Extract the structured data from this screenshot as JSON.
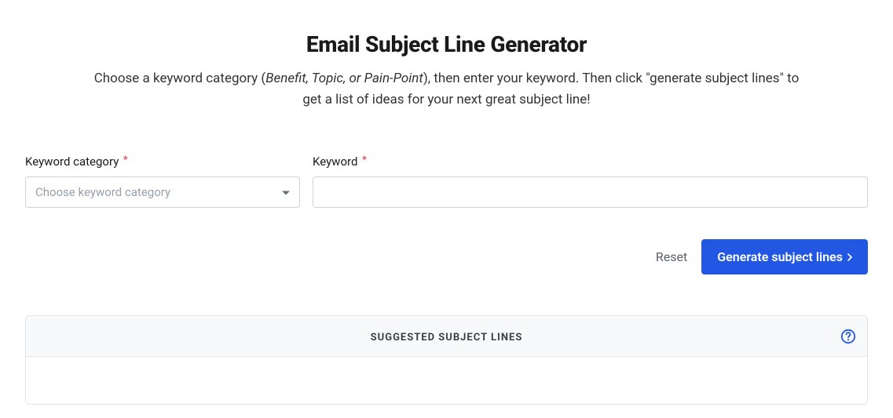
{
  "header": {
    "title": "Email Subject Line Generator",
    "subtitle_pre": "Choose a keyword category (",
    "subtitle_italic": "Benefit, Topic, or Pain-Point",
    "subtitle_post": "), then enter your keyword. Then click \"generate subject lines\" to get a list of ideas for your next great subject line!"
  },
  "form": {
    "category_label": "Keyword category",
    "category_placeholder": "Choose keyword category",
    "keyword_label": "Keyword",
    "required_mark": "*"
  },
  "buttons": {
    "reset": "Reset",
    "generate": "Generate subject lines"
  },
  "panel": {
    "title": "SUGGESTED SUBJECT LINES"
  }
}
